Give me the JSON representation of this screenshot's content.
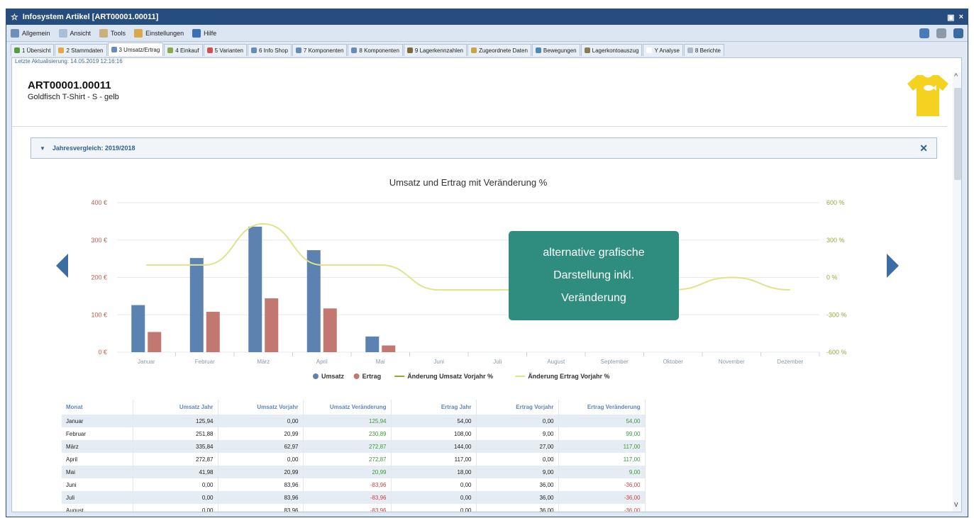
{
  "window": {
    "title": "Infosystem Artikel [ART00001.00011]"
  },
  "menu": [
    {
      "label": "Allgemein",
      "icon": "settings-icon"
    },
    {
      "label": "Ansicht",
      "icon": "view-icon"
    },
    {
      "label": "Tools",
      "icon": "tools-icon"
    },
    {
      "label": "Einstellungen",
      "icon": "preferences-icon"
    },
    {
      "label": "Hilfe",
      "icon": "help-icon"
    }
  ],
  "tabs": [
    {
      "label": "1 Übersicht"
    },
    {
      "label": "2 Stammdaten"
    },
    {
      "label": "3 Umsatz/Ertrag"
    },
    {
      "label": "4 Einkauf"
    },
    {
      "label": "5 Varianten"
    },
    {
      "label": "6 Info Shop"
    },
    {
      "label": "7 Komponenten"
    },
    {
      "label": "8 Komponenten"
    },
    {
      "label": "9 Lagerkennzahlen"
    },
    {
      "label": "Zugeordnete Daten"
    },
    {
      "label": "Bewegungen"
    },
    {
      "label": "Lagerkontoauszug"
    },
    {
      "label": "Y Analyse"
    },
    {
      "label": "8 Berichte"
    }
  ],
  "active_tab": 2,
  "last_update": "Letzte Aktualisierung: 14.05.2019 12:16:16",
  "article": {
    "id": "ART00001.00011",
    "desc": "Goldfisch T-Shirt - S - gelb"
  },
  "panel": {
    "title": "Jahresvergleich: 2019/2018",
    "close": "✕"
  },
  "callout": {
    "line1": "alternative grafische",
    "line2": "Darstellung inkl.",
    "line3": "Veränderung"
  },
  "chart_data": {
    "type": "bar",
    "title": "Umsatz und Ertrag mit Veränderung %",
    "categories": [
      "Januar",
      "Februar",
      "März",
      "April",
      "Mai",
      "Juni",
      "Juli",
      "August",
      "September",
      "Oktober",
      "November",
      "Dezember"
    ],
    "y_left": {
      "ticks": [
        "0 €",
        "100 €",
        "200 €",
        "300 €",
        "400 €"
      ],
      "range": [
        0,
        400
      ]
    },
    "y_right": {
      "ticks": [
        "-600 %",
        "-300 %",
        "0 %",
        "300 %",
        "600 %"
      ],
      "range": [
        -600,
        600
      ]
    },
    "series": [
      {
        "name": "Umsatz",
        "type": "bar",
        "color": "#5b82b0",
        "values": [
          125.94,
          251.88,
          335.84,
          272.87,
          41.98,
          0,
          0,
          0,
          0,
          0,
          0,
          0
        ]
      },
      {
        "name": "Ertrag",
        "type": "bar",
        "color": "#c27770",
        "values": [
          54.0,
          108.0,
          144.0,
          117.0,
          18.0,
          0,
          0,
          0,
          0,
          0,
          0,
          0
        ]
      },
      {
        "name": "Änderung Umsatz Vorjahr %",
        "type": "line",
        "color": "#9aa83a",
        "values": []
      },
      {
        "name": "Änderung Ertrag Vorjahr %",
        "type": "line",
        "color": "#dfe38a",
        "values": [
          100,
          100,
          430,
          100,
          100,
          -100,
          -100,
          -100,
          -100,
          -100,
          0,
          -100
        ]
      }
    ],
    "legend_position": "bottom"
  },
  "table": {
    "headers": [
      "Monat",
      "Umsatz Jahr",
      "Umsatz Vorjahr",
      "Umsatz Veränderung",
      "Ertrag Jahr",
      "Ertrag Vorjahr",
      "Ertrag Veränderung"
    ],
    "rows": [
      [
        "Januar",
        "125,94",
        "0,00",
        "125,94",
        "54,00",
        "0,00",
        "54,00"
      ],
      [
        "Februar",
        "251,88",
        "20,99",
        "230,89",
        "108,00",
        "9,00",
        "99,00"
      ],
      [
        "März",
        "335,84",
        "62,97",
        "272,87",
        "144,00",
        "27,00",
        "117,00"
      ],
      [
        "April",
        "272,87",
        "0,00",
        "272,87",
        "117,00",
        "0,00",
        "117,00"
      ],
      [
        "Mai",
        "41,98",
        "20,99",
        "20,99",
        "18,00",
        "9,00",
        "9,00"
      ],
      [
        "Juni",
        "0,00",
        "83,96",
        "-83,96",
        "0,00",
        "36,00",
        "-36,00"
      ],
      [
        "Juli",
        "0,00",
        "83,96",
        "-83,96",
        "0,00",
        "36,00",
        "-36,00"
      ],
      [
        "August",
        "0,00",
        "83,96",
        "-83,96",
        "0,00",
        "36,00",
        "-36,00"
      ]
    ]
  }
}
